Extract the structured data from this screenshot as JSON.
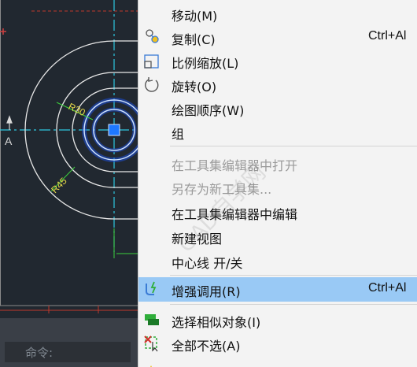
{
  "canvas": {
    "dims": {
      "r30": "R30",
      "r45": "R45"
    },
    "ucs_axis_label": "A",
    "command_prompt": "命令:"
  },
  "menu": {
    "items": [
      {
        "label": "移动(M)",
        "shortcut": "",
        "icon": "",
        "enabled": true
      },
      {
        "label": "复制(C)",
        "shortcut": "Ctrl+Al",
        "icon": "copy-icon",
        "enabled": true
      },
      {
        "label": "比例缩放(L)",
        "shortcut": "",
        "icon": "scale-icon",
        "enabled": true
      },
      {
        "label": "旋转(O)",
        "shortcut": "",
        "icon": "rotate-icon",
        "enabled": true
      },
      {
        "label": "绘图顺序(W)",
        "shortcut": "",
        "icon": "",
        "enabled": true
      },
      {
        "label": "组",
        "shortcut": "",
        "icon": "",
        "enabled": true
      },
      {
        "label": "在工具集编辑器中打开",
        "shortcut": "",
        "icon": "",
        "enabled": false
      },
      {
        "label": "另存为新工具集...",
        "shortcut": "",
        "icon": "",
        "enabled": false
      },
      {
        "label": "在工具集编辑器中编辑",
        "shortcut": "",
        "icon": "",
        "enabled": true
      },
      {
        "label": "新建视图",
        "shortcut": "",
        "icon": "",
        "enabled": true
      },
      {
        "label": "中心线 开/关",
        "shortcut": "",
        "icon": "",
        "enabled": true
      },
      {
        "label": "增强调用(R)",
        "shortcut": "Ctrl+Al",
        "icon": "enhanced-call-icon",
        "enabled": true,
        "highlighted": true
      },
      {
        "label": "选择相似对象(I)",
        "shortcut": "",
        "icon": "select-similar-icon",
        "enabled": true
      },
      {
        "label": "全部不选(A)",
        "shortcut": "",
        "icon": "deselect-all-icon",
        "enabled": true
      }
    ]
  },
  "watermark": "CAD自学网",
  "colors": {
    "highlight": "#99c9f5",
    "canvas_bg": "#212830",
    "accent_cyan": "#2ec8e0",
    "dim_green": "#3ccf3c"
  }
}
